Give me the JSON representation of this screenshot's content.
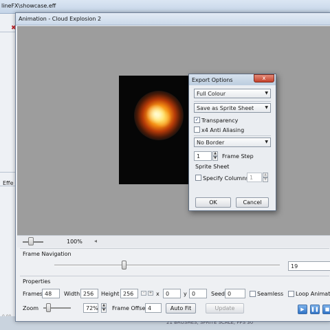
{
  "background_app": {
    "title": "lineFX\\showcase.eff",
    "left_panel_label": "Effe",
    "status_text": "21 BRUSHES, SPRITE SCALE, FPS 30",
    "corner_number": "0.00"
  },
  "window": {
    "title": "Animation - Cloud Explosion 2"
  },
  "zoom_bar": {
    "percent": "100%",
    "slider_level": 0.3
  },
  "frame_navigation": {
    "heading": "Frame Navigation",
    "value": "19",
    "slider_level": 0.39
  },
  "properties": {
    "heading": "Properties",
    "frames_label": "Frames",
    "frames_value": "48",
    "width_label": "Width",
    "width_value": "256",
    "height_label": "Height",
    "height_value": "256",
    "minus_label": "-",
    "plus_label": "+",
    "x_label": "x",
    "x_value": "0",
    "y_label": "y",
    "y_value": "0",
    "seed_label": "Seed",
    "seed_value": "0",
    "seamless_label": "Seamless",
    "loop_label": "Loop Animation",
    "zoom_label": "Zoom",
    "zoom_value": "72%",
    "frame_offset_label": "Frame Offset",
    "frame_offset_value": "4",
    "auto_fit_label": "Auto Fit",
    "update_label": "Update"
  },
  "export_dialog": {
    "title": "Export Options",
    "close_label": "x",
    "colour_mode": "Full Colour",
    "save_mode": "Save as Sprite Sheet",
    "transparency_label": "Transparency",
    "transparency_checked": true,
    "anti_alias_label": "x4 Anti Aliasing",
    "anti_alias_checked": false,
    "border_mode": "No Border",
    "frame_step_value": "1",
    "frame_step_label": "Frame Step",
    "sprite_sheet_label": "Sprite Sheet",
    "specify_columns_label": "Specify Columns",
    "columns_value": "1",
    "ok_label": "OK",
    "cancel_label": "Cancel",
    "check_mark": "✓"
  },
  "icons": {
    "play": "play-icon",
    "pause": "pause-icon",
    "stop": "stop-icon"
  },
  "colors": {
    "viewport_bg": "#9d9d9d",
    "accent_blue": "#2f73c6",
    "close_red": "#c4412a"
  }
}
